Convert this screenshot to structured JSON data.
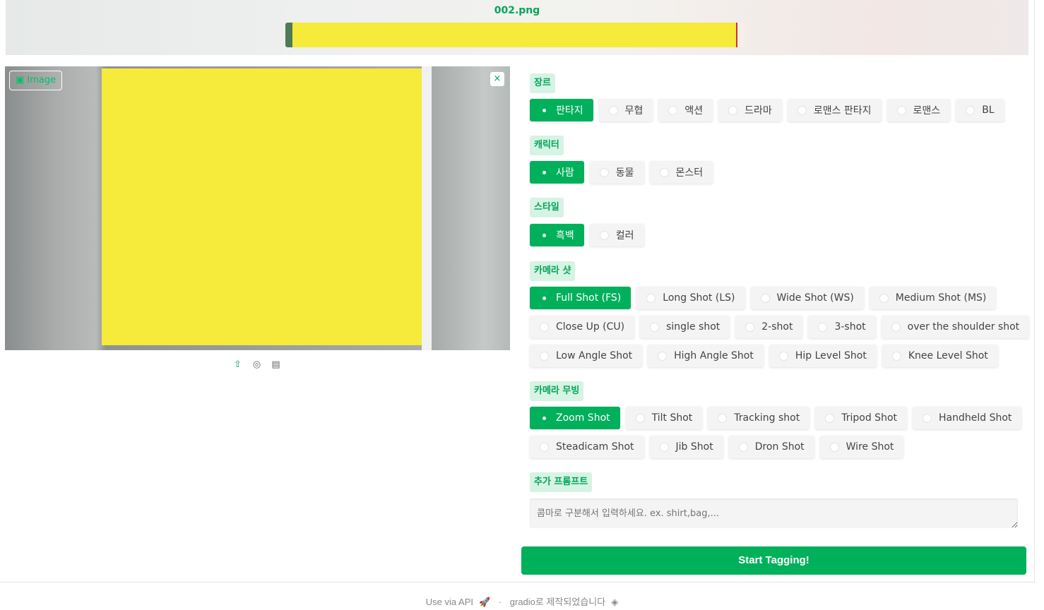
{
  "banner": {
    "filename": "002.png"
  },
  "image_panel": {
    "label": "Image",
    "close_glyph": "×",
    "icons": [
      "upload-icon",
      "webcam-icon",
      "clipboard-icon"
    ]
  },
  "sections": {
    "genre": {
      "label": "장르",
      "options": [
        "판타지",
        "무협",
        "액션",
        "드라마",
        "로맨스 판타지",
        "로맨스",
        "BL"
      ],
      "selected": 0
    },
    "character": {
      "label": "캐릭터",
      "options": [
        "사람",
        "동물",
        "몬스터"
      ],
      "selected": 0
    },
    "style": {
      "label": "스타일",
      "options": [
        "흑백",
        "컬러"
      ],
      "selected": 0
    },
    "camera_shot": {
      "label": "카메라 샷",
      "rows": [
        [
          "Full Shot (FS)",
          "Long Shot (LS)",
          "Wide Shot (WS)",
          "Medium Shot (MS)"
        ],
        [
          "Close Up (CU)",
          "single shot",
          "2-shot",
          "3-shot",
          "over the shoulder shot"
        ],
        [
          "Low Angle Shot",
          "High Angle Shot",
          "Hip Level Shot",
          "Knee Level Shot"
        ]
      ],
      "selected": "Full Shot (FS)"
    },
    "camera_moving": {
      "label": "카메라 무빙",
      "rows": [
        [
          "Zoom Shot",
          "Tilt Shot",
          "Tracking shot",
          "Tripod Shot",
          "Handheld Shot"
        ],
        [
          "Steadicam Shot",
          "Jib Shot",
          "Dron Shot",
          "Wire Shot"
        ]
      ],
      "selected": "Zoom Shot"
    },
    "extra_prompt": {
      "label": "추가 프롬프트",
      "placeholder": "콤마로 구분해서 입력하세요. ex. shirt,bag,..."
    }
  },
  "start_button": "Start Tagging!",
  "footer": {
    "api": "Use via API",
    "sep": "·",
    "built": "gradio로 제작되었습니다"
  },
  "colors": {
    "accent": "#00b05b",
    "label_bg": "#d6f3e4"
  }
}
